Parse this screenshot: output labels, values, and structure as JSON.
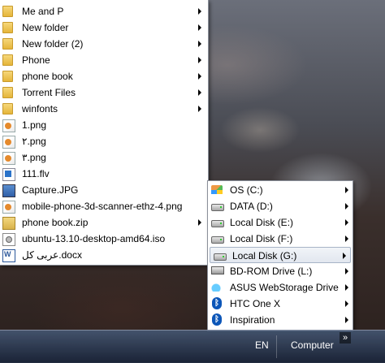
{
  "files": [
    {
      "label": "Me and P",
      "icon": "folder-icon",
      "submenu": true
    },
    {
      "label": "New folder",
      "icon": "folder-icon",
      "submenu": true
    },
    {
      "label": "New folder (2)",
      "icon": "folder-icon",
      "submenu": true
    },
    {
      "label": "Phone",
      "icon": "folder-icon",
      "submenu": true
    },
    {
      "label": "phone book",
      "icon": "folder-icon",
      "submenu": true
    },
    {
      "label": "Torrent Files",
      "icon": "folder-icon",
      "submenu": true
    },
    {
      "label": "winfonts",
      "icon": "folder-icon",
      "submenu": true
    },
    {
      "label": "1.png",
      "icon": "png-file-icon",
      "submenu": false
    },
    {
      "label": "۲.png",
      "icon": "png-file-icon",
      "submenu": false
    },
    {
      "label": "۳.png",
      "icon": "png-file-icon",
      "submenu": false
    },
    {
      "label": "111.flv",
      "icon": "video-file-icon",
      "submenu": false
    },
    {
      "label": "Capture.JPG",
      "icon": "image-file-icon",
      "submenu": false
    },
    {
      "label": "mobile-phone-3d-scanner-ethz-4.png",
      "icon": "png-file-icon",
      "submenu": false
    },
    {
      "label": "phone book.zip",
      "icon": "zip-file-icon",
      "submenu": true
    },
    {
      "label": "ubuntu-13.10-desktop-amd64.iso",
      "icon": "disc-image-icon",
      "submenu": false
    },
    {
      "label": "عربی کل.docx",
      "icon": "word-document-icon",
      "submenu": false
    }
  ],
  "drives": [
    {
      "label": "OS (C:)",
      "icon": "windows-drive-icon",
      "highlighted": false
    },
    {
      "label": "DATA (D:)",
      "icon": "hard-disk-icon",
      "highlighted": false
    },
    {
      "label": "Local Disk (E:)",
      "icon": "hard-disk-icon",
      "highlighted": false
    },
    {
      "label": "Local Disk (F:)",
      "icon": "hard-disk-icon",
      "highlighted": false
    },
    {
      "label": "Local Disk (G:)",
      "icon": "hard-disk-icon",
      "highlighted": true
    },
    {
      "label": "BD-ROM Drive (L:)",
      "icon": "optical-drive-icon",
      "highlighted": false
    },
    {
      "label": "ASUS WebStorage Drive",
      "icon": "cloud-drive-icon",
      "highlighted": false
    },
    {
      "label": "HTC One X",
      "icon": "bluetooth-icon",
      "highlighted": false
    },
    {
      "label": "Inspiration",
      "icon": "bluetooth-icon",
      "highlighted": false
    }
  ],
  "taskbar": {
    "language": "EN",
    "toolbar_label": "Computer",
    "chevron": "»"
  }
}
